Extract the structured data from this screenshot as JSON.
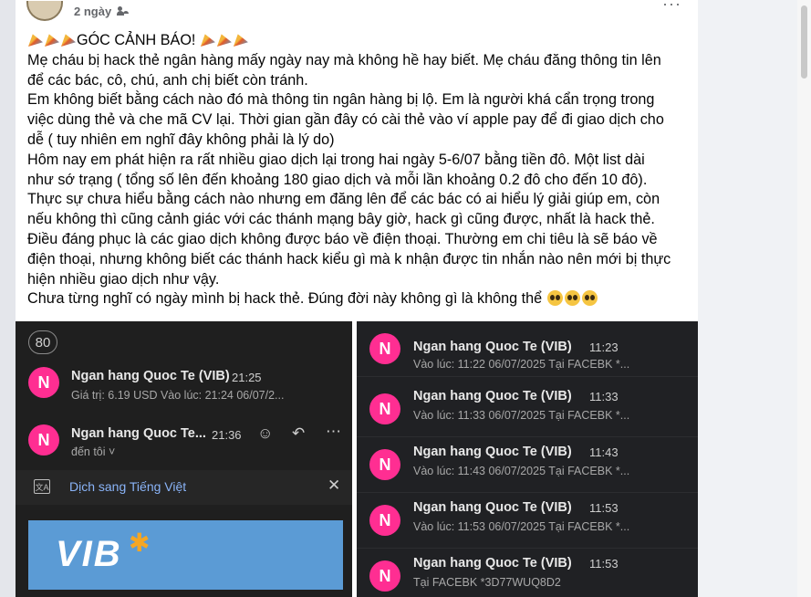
{
  "post": {
    "time": "2 ngày",
    "audience_icon": "friends-icon",
    "more_label": "···",
    "title": "GÓC CẢNH BÁO!",
    "paragraphs": [
      "Mẹ cháu bị hack thẻ ngân hàng mấy ngày nay mà không hề hay biết. Mẹ cháu đăng thông tin lên",
      "để các bác, cô, chú, anh chị biết còn tránh.",
      "Em không biết bằng cách nào đó mà thông tin ngân hàng bị lộ. Em là người khá cẩn trọng trong",
      "việc dùng thẻ và che mã CV lại. Thời gian gần đây có cài thẻ vào ví apple pay để đi giao dịch cho",
      "dễ ( tuy nhiên em nghĩ đây không phải là lý do)",
      "Hôm nay em phát hiện ra rất nhiều giao dịch lại trong hai ngày 5-6/07 bằng tiền đô. Một list dài",
      "như sớ trạng ( tổng số lên đến khoảng 180 giao dịch và mỗi lần khoảng 0.2 đô cho đến 10 đô).",
      "Thực sự chưa hiểu bằng cách nào nhưng em đăng lên để các bác có ai hiểu lý giải giúp em, còn",
      "nếu không thì cũng cảnh giác với các thánh mạng bây giờ, hack gì cũng được, nhất là hack thẻ.",
      "Điều đáng phục là các giao dịch không được báo về điện thoại. Thường em chi tiêu là sẽ báo về",
      "điện thoại, nhưng không biết các thánh hack kiểu gì mà k nhận được tin nhắn nào nên mới bị thực",
      "hiện nhiều giao dịch như vậy."
    ],
    "last_line": "Chưa từng nghĩ có ngày mình bị hack thẻ. Đúng đời này không gì là không thể"
  },
  "left_shot": {
    "count_badge": "80",
    "email1": {
      "avatar_letter": "N",
      "sender": "Ngan hang Quoc Te (VIB)",
      "time": "21:25",
      "snippet": "Giá trị: 6.19 USD Vào lúc: 21:24 06/07/2..."
    },
    "email2": {
      "avatar_letter": "N",
      "sender": "Ngan hang Quoc Te...",
      "time": "21:36",
      "recipient": "đến tôi ˅"
    },
    "translate_label": "Dịch sang Tiếng Việt",
    "close_label": "✕",
    "logo_text": "VIB"
  },
  "right_shot": {
    "items": [
      {
        "avatar_letter": "N",
        "sender": "Ngan hang Quoc Te (VIB)",
        "time": "11:23",
        "snippet": "Vào lúc: 11:22 06/07/2025 Tại FACEBK *..."
      },
      {
        "avatar_letter": "N",
        "sender": "Ngan hang Quoc Te (VIB)",
        "time": "11:33",
        "snippet": "Vào lúc: 11:33 06/07/2025 Tại FACEBK *..."
      },
      {
        "avatar_letter": "N",
        "sender": "Ngan hang Quoc Te (VIB)",
        "time": "11:43",
        "snippet": "Vào lúc: 11:43 06/07/2025 Tại FACEBK *..."
      },
      {
        "avatar_letter": "N",
        "sender": "Ngan hang Quoc Te (VIB)",
        "time": "11:53",
        "snippet": "Vào lúc: 11:53 06/07/2025 Tại FACEBK *..."
      },
      {
        "avatar_letter": "N",
        "sender": "Ngan hang Quoc Te (VIB)",
        "time": "11:53",
        "snippet": "Tại FACEBK *3D77WUQ8D2"
      }
    ]
  },
  "colors": {
    "avatar_pink": "#ff2e92",
    "dark_bg": "#1f1f1f",
    "link_blue": "#8ab4f8",
    "vib_blue": "#5b9bd5"
  }
}
